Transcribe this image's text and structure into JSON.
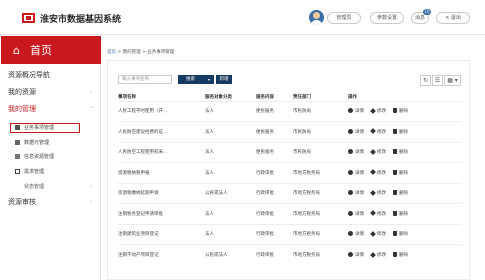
{
  "app": {
    "title": "淮安市数据基因系统"
  },
  "header": {
    "user_label": "管理员",
    "ref_label": "参数设置",
    "msg_label": "消息",
    "badge_count": "10",
    "exit_label": "× 退出"
  },
  "sidebar": {
    "home_icon": "⌂",
    "home_label": "首页",
    "items": [
      {
        "label": "资源概况导航",
        "chevron": ""
      },
      {
        "label": "我的资源",
        "chevron": "›"
      },
      {
        "label": "我的管理",
        "chevron": "⌄"
      },
      {
        "label": "资源审核",
        "chevron": "›"
      }
    ],
    "sub_items": [
      {
        "label": "业务事项管理",
        "icon": "bar-chart-icon"
      },
      {
        "label": "数据元管理",
        "icon": "grid-icon"
      },
      {
        "label": "信息资源管理",
        "icon": "line-chart-icon"
      },
      {
        "label": "需求管理",
        "icon": "square-icon"
      }
    ],
    "other_item": "状态管理",
    "other_chevron": "›"
  },
  "breadcrumb": {
    "first": "首页",
    "rest": " > 我的管理 > 业务事项管理"
  },
  "toolbar": {
    "search_placeholder": "输入事项名称",
    "search_label": "搜索",
    "search_dd": "▾",
    "add_label": "新增",
    "refresh_icon": "↻",
    "columns_icon": "☰",
    "grid_icon": "▦ ▾"
  },
  "table": {
    "headers": [
      "事项名称",
      "服务对象分类",
      "服务内容",
      "责任部门",
      "操作"
    ],
    "actions": {
      "info": "详情",
      "edit": "修改",
      "del": "删除"
    },
    "rows": [
      [
        "人民工程平时使用（开...",
        "法人",
        "便民服务",
        "市民防局"
      ],
      [
        "人民防空建设经费的征...",
        "法人",
        "便民服务",
        "市民防局"
      ],
      [
        "人民防空工程使用权采...",
        "法人",
        "便民服务",
        "市民防局"
      ],
      [
        "资源税纳税申报",
        "法人",
        "行政审批",
        "市地方税务局"
      ],
      [
        "资源税缴纳延期申请",
        "公民或法人",
        "行政审批",
        "市地方税务局"
      ],
      [
        "注销税务登记申请审批",
        "法人",
        "行政审批",
        "市地方税务局"
      ],
      [
        "注销建筑业项目登记",
        "法人",
        "行政审批",
        "市地方税务局"
      ],
      [
        "注销不动产项目登记",
        "公民或法人",
        "行政审批",
        "市地方税务局"
      ]
    ]
  },
  "colors": {
    "brand": "#c9191f",
    "primary_button": "#173a63",
    "link": "#3a6ea5"
  }
}
